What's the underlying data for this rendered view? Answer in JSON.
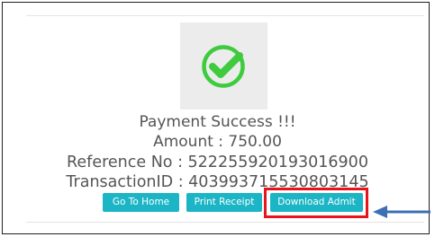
{
  "status": {
    "icon": "check-circle-icon",
    "title": "Payment Success !!!",
    "amount": "Amount : 750.00",
    "reference": "Reference No : 522255920193016900",
    "transaction": "TransactionID : 403993715530803145"
  },
  "buttons": {
    "home": "Go To Home",
    "print": "Print Receipt",
    "download": "Download Admit"
  },
  "colors": {
    "button": "#1cb5c5",
    "success_green": "#3ecb3e",
    "highlight_red": "#e8141c",
    "arrow_blue": "#3d6fb5"
  }
}
